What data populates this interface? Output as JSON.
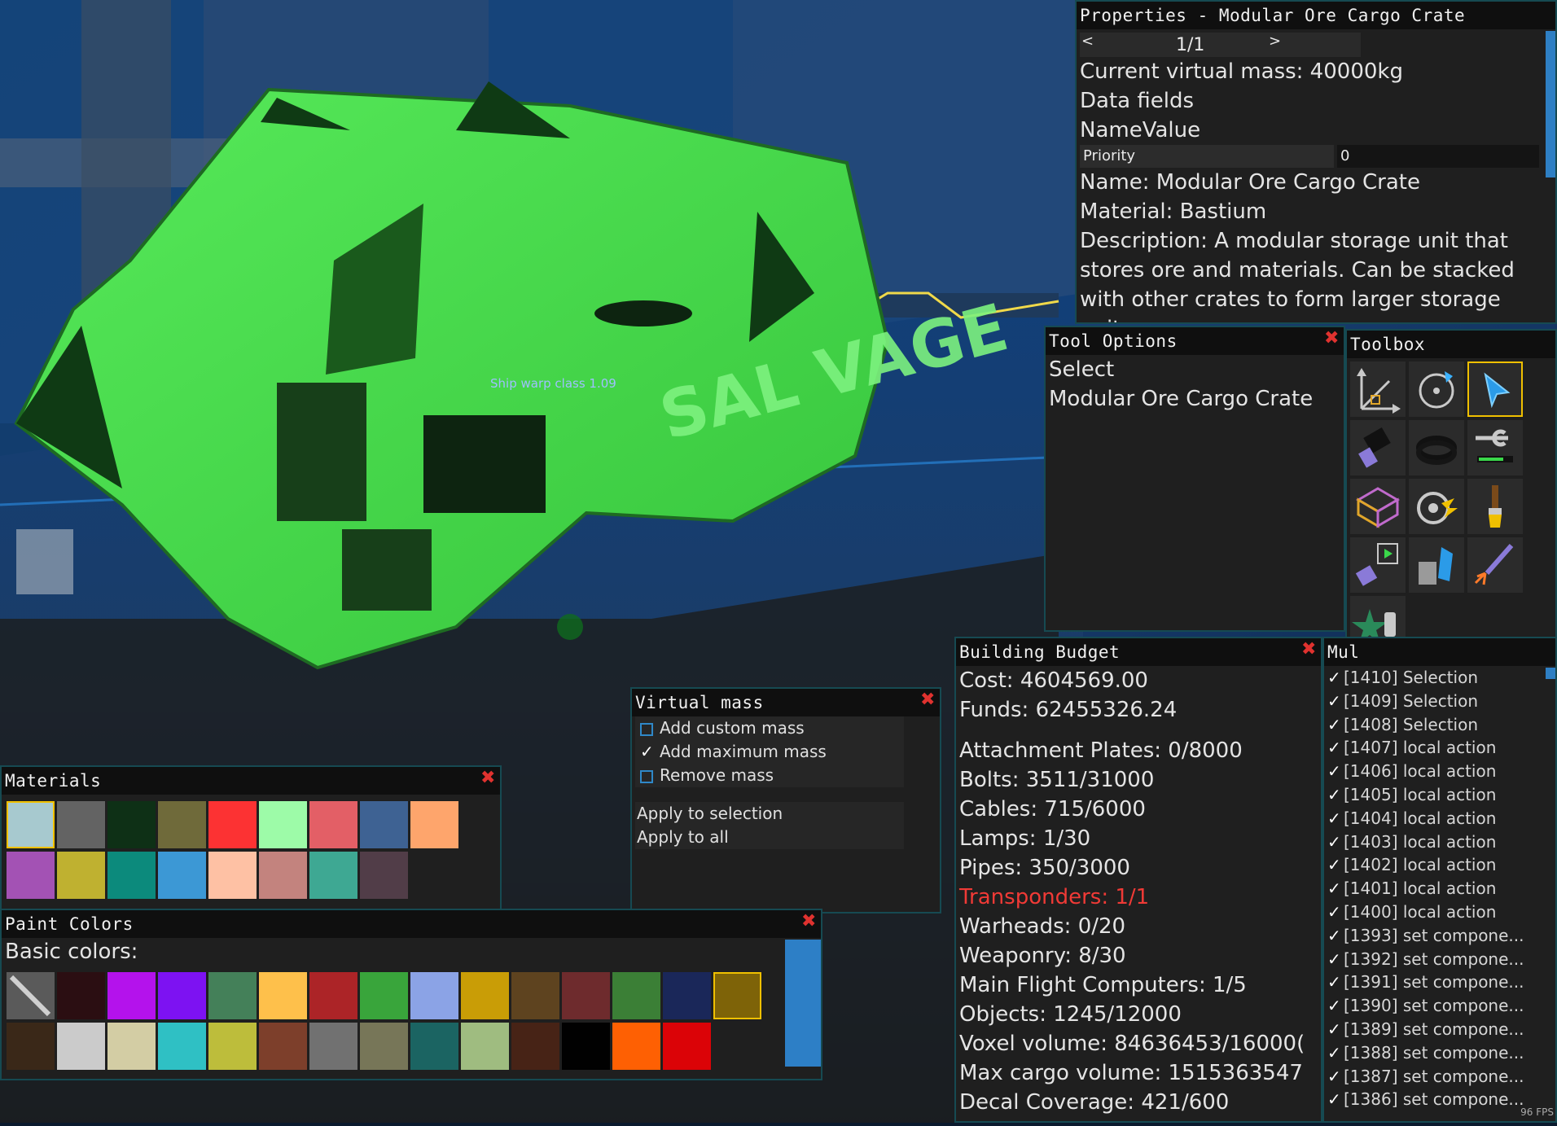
{
  "viewport": {
    "ship_label": "Ship warp class 1.09",
    "hull_text": "SAL VAGE"
  },
  "properties": {
    "title": "Properties - Modular Ore Cargo Crate",
    "pager": {
      "prev": "<",
      "page": "1/1",
      "next": ">"
    },
    "virtual_mass": "Current virtual mass: 40000kg",
    "data_fields": "Data fields",
    "name_value_header": "NameValue",
    "priority_label": "Priority",
    "priority_value": "0",
    "name": "Name: Modular Ore Cargo Crate",
    "material": "Material: Bastium",
    "description": "Description: A modular storage unit that stores ore and materials. Can be stacked with other crates to form larger storage units."
  },
  "tool_options": {
    "title": "Tool Options",
    "lines": [
      "Select",
      "Modular Ore Cargo Crate"
    ]
  },
  "toolbox": {
    "title": "Toolbox",
    "tools": [
      {
        "icon": "axis-move-icon"
      },
      {
        "icon": "rotate-icon"
      },
      {
        "icon": "select-cursor-icon",
        "active": true
      },
      {
        "icon": "cable-plug-icon"
      },
      {
        "icon": "cable-coil-icon"
      },
      {
        "icon": "wrench-icon"
      },
      {
        "icon": "voxel-grid-icon"
      },
      {
        "icon": "warp-disc-icon"
      },
      {
        "icon": "paint-brush-icon"
      },
      {
        "icon": "logic-plug-icon"
      },
      {
        "icon": "crystal-ore-icon"
      },
      {
        "icon": "welder-icon"
      },
      {
        "icon": "decal-star-icon"
      }
    ]
  },
  "building_budget": {
    "title": "Building Budget",
    "cost": "Cost: 4604569.00",
    "funds": "Funds: 62455326.24",
    "items": [
      {
        "text": "Attachment Plates: 0/8000",
        "warn": false
      },
      {
        "text": "Bolts: 3511/31000",
        "warn": false
      },
      {
        "text": "Cables: 715/6000",
        "warn": false
      },
      {
        "text": "Lamps: 1/30",
        "warn": false
      },
      {
        "text": "Pipes: 350/3000",
        "warn": false
      },
      {
        "text": "Transponders: 1/1",
        "warn": true
      },
      {
        "text": "Warheads: 0/20",
        "warn": false
      },
      {
        "text": "Weaponry: 8/30",
        "warn": false
      },
      {
        "text": "Main Flight Computers: 1/5",
        "warn": false
      },
      {
        "text": "Objects: 1245/12000",
        "warn": false
      },
      {
        "text": "Voxel volume: 84636453/16000(",
        "warn": false
      },
      {
        "text": "Max cargo volume: 1515363547",
        "warn": false
      },
      {
        "text": "Decal Coverage: 421/600",
        "warn": false
      }
    ]
  },
  "history": {
    "title": "Mul",
    "items": [
      "[1410] Selection",
      "[1409] Selection",
      "[1408] Selection",
      "[1407] local action",
      "[1406] local action",
      "[1405] local action",
      "[1404] local action",
      "[1403] local action",
      "[1402] local action",
      "[1401] local action",
      "[1400] local action",
      "[1393] set compone...",
      "[1392] set compone...",
      "[1391] set compone...",
      "[1390] set compone...",
      "[1389] set compone...",
      "[1388] set compone...",
      "[1387] set compone...",
      "[1386] set compone..."
    ],
    "check": "✓"
  },
  "fps": "96 FPS",
  "virtual_mass": {
    "title": "Virtual mass",
    "options": [
      {
        "label": "Add custom mass",
        "checked": false
      },
      {
        "label": "Add maximum mass",
        "checked": true
      },
      {
        "label": "Remove mass",
        "checked": false
      }
    ],
    "apply_selection": "Apply to selection",
    "apply_all": "Apply to all"
  },
  "materials": {
    "title": "Materials",
    "swatches": [
      "#a7c9cf",
      "#636363",
      "#0e3016",
      "#6f6a3a",
      "#fc3233",
      "#9dfba8",
      "#e35f66",
      "#3e6293",
      "#fea56c",
      "#a352b4",
      "#bfb130",
      "#0c8a7c",
      "#3c98d5",
      "#fec1a4",
      "#c3837e",
      "#3ea893",
      "#513d48"
    ]
  },
  "paint_colors": {
    "title": "Paint Colors",
    "basic_label": "Basic colors:",
    "row1": [
      "none",
      "#2b0e12",
      "#b412ec",
      "#7d12f2",
      "#448059",
      "#fec04b",
      "#ac2427",
      "#39a53b",
      "#8ba3e6",
      "#c99d06",
      "#5e431f",
      "#6e2b2d",
      "#3b7f36",
      "#1a2759",
      "#7e6308"
    ],
    "row2": [
      "#3a2818",
      "#cbcbcb",
      "#d3cda4",
      "#2fc0c4",
      "#bdbd3b",
      "#7d3f2b",
      "#717171",
      "#777658",
      "#1b6462",
      "#9fbc80",
      "#472316",
      "#010101",
      "#fe6003",
      "#db0307"
    ],
    "current": "#2d7fc6"
  }
}
